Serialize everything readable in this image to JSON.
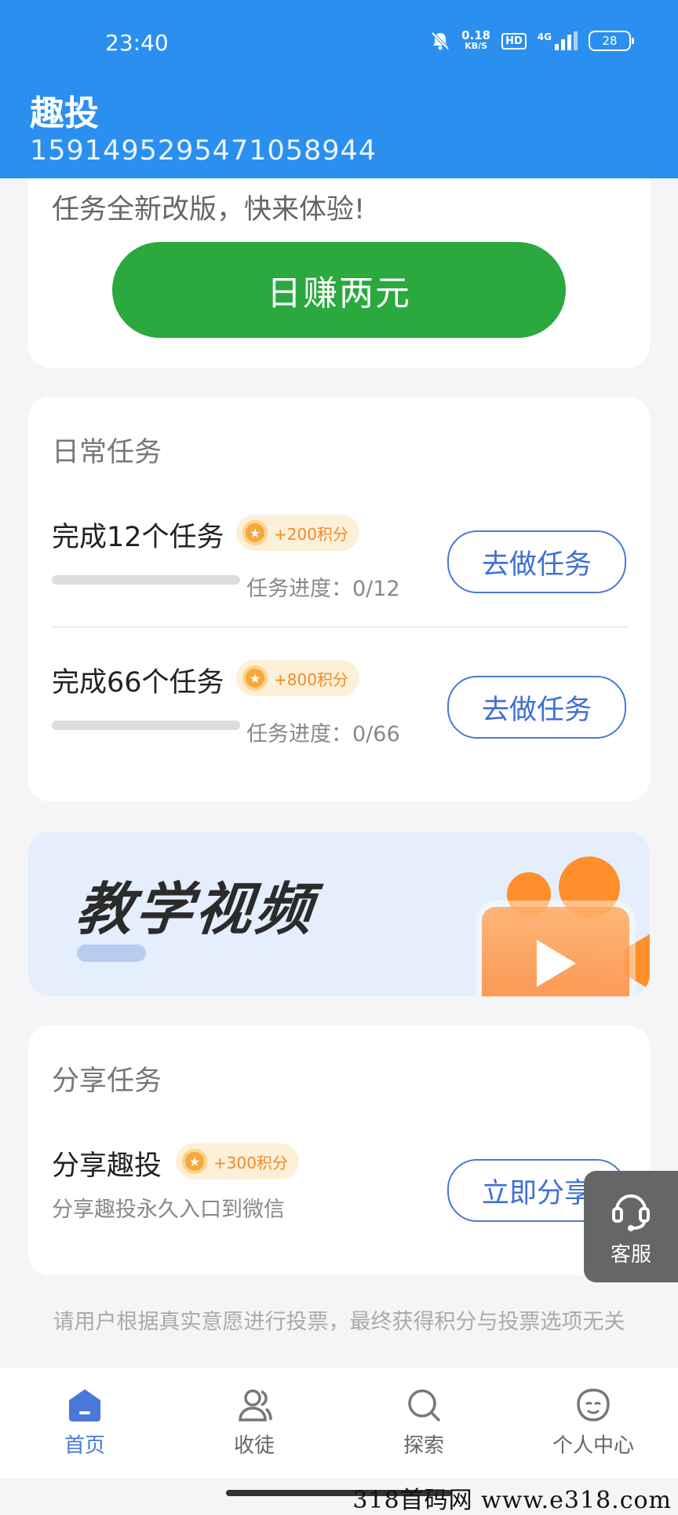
{
  "status_bar": {
    "time": "23:40",
    "speed_value": "0.18",
    "speed_unit": "KB/S",
    "hd": "HD",
    "network": "4G",
    "battery": "28"
  },
  "header": {
    "title": "趣投",
    "subtitle": "1591495295471058944"
  },
  "promo": {
    "text": "任务全新改版，快来体验!",
    "button_label": "日赚两元"
  },
  "daily": {
    "title": "日常任务",
    "tasks": [
      {
        "name": "完成12个任务",
        "points": "+200积分",
        "progress_label": "任务进度：0/12",
        "progress": 0,
        "button": "去做任务"
      },
      {
        "name": "完成66个任务",
        "points": "+800积分",
        "progress_label": "任务进度：0/66",
        "progress": 0,
        "button": "去做任务"
      }
    ]
  },
  "banner": {
    "title": "教学视频"
  },
  "share": {
    "title": "分享任务",
    "task_name": "分享趣投",
    "points": "+300积分",
    "desc": "分享趣投永久入口到微信",
    "button": "立即分享"
  },
  "service": {
    "label": "客服"
  },
  "footer_note": "请用户根据真实意愿进行投票，最终获得积分与投票选项无关",
  "nav": {
    "items": [
      {
        "label": "首页",
        "icon": "home-icon",
        "active": true
      },
      {
        "label": "收徒",
        "icon": "users-icon",
        "active": false
      },
      {
        "label": "探索",
        "icon": "search-icon",
        "active": false
      },
      {
        "label": "个人中心",
        "icon": "profile-icon",
        "active": false
      }
    ]
  },
  "watermark": "318首码网  www.e318.com",
  "colors": {
    "header_bg": "#2b8ff0",
    "green_button": "#2ba83e",
    "accent_blue": "#4a78d8",
    "points_orange": "#f08a27"
  }
}
